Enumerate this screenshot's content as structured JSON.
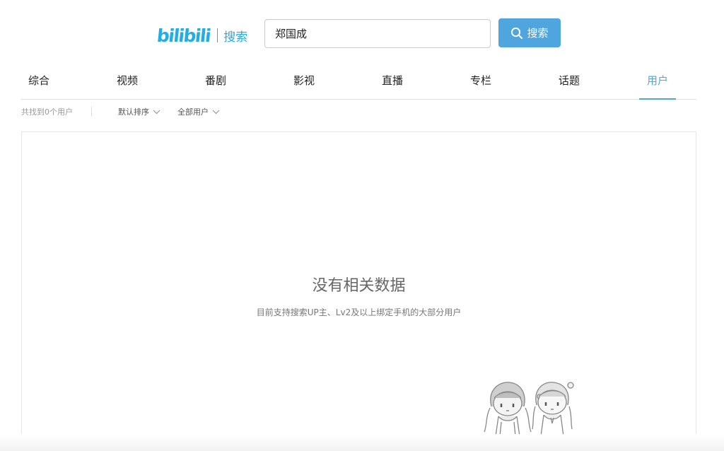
{
  "header": {
    "logo_text": "bilibili",
    "logo_subtitle": "搜索",
    "search_value": "郑国成",
    "search_button_label": "搜索"
  },
  "tabs": [
    {
      "label": "综合",
      "active": false
    },
    {
      "label": "视频",
      "active": false
    },
    {
      "label": "番剧",
      "active": false
    },
    {
      "label": "影视",
      "active": false
    },
    {
      "label": "直播",
      "active": false
    },
    {
      "label": "专栏",
      "active": false
    },
    {
      "label": "话题",
      "active": false
    },
    {
      "label": "用户",
      "active": true
    }
  ],
  "filters": {
    "result_count": "共找到0个用户",
    "sort_label": "默认排序",
    "user_type_label": "全部用户"
  },
  "empty_state": {
    "title": "没有相关数据",
    "description": "目前支持搜索UP主、Lv2及以上绑定手机的大部分用户"
  },
  "colors": {
    "brand": "#23ade5",
    "accent": "#4fa5dd"
  },
  "icons": {
    "search": "search-icon",
    "dropdown": "chevron-down-icon"
  }
}
